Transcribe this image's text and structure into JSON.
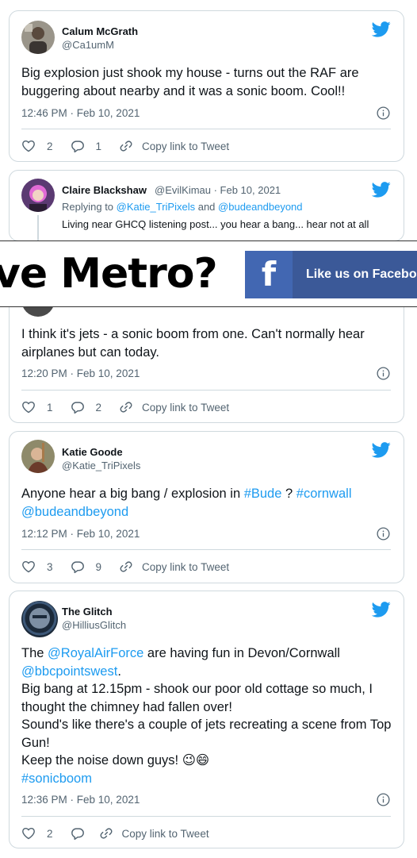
{
  "tweets": [
    {
      "name": "Calum McGrath",
      "handle": "@Ca1umM",
      "text": "Big explosion just shook my house - turns out the RAF are buggering about nearby and it was a sonic boom. Cool!!",
      "timestamp": "12:46 PM · Feb 10, 2021",
      "likes": "2",
      "replies": "1",
      "copy_label": "Copy link to Tweet"
    },
    {
      "name": "Claire Blackshaw",
      "handle_date": "@EvilKimau · Feb 10, 2021",
      "reply_prefix": "Replying to",
      "reply_handle_1": "@Katie_TriPixels",
      "reply_and": "and",
      "reply_handle_2": "@budeandbeyond",
      "partial_text": "Living near GHCQ listening post... you hear a bang... hear not at all"
    },
    {
      "text": "I think it's jets - a sonic boom from one. Can't normally hear airplanes but can today.",
      "timestamp": "12:20 PM · Feb 10, 2021",
      "likes": "1",
      "replies": "2",
      "copy_label": "Copy link to Tweet"
    },
    {
      "name": "Katie Goode",
      "handle": "@Katie_TriPixels",
      "text_a": "Anyone hear a big bang / explosion in ",
      "link_a": "#Bude",
      "text_b": " ? ",
      "link_b": "#cornwall",
      "link_c": "@budeandbeyond",
      "timestamp": "12:12 PM · Feb 10, 2021",
      "likes": "3",
      "replies": "9",
      "copy_label": "Copy link to Tweet"
    },
    {
      "name": "The Glitch",
      "handle": "@HilliusGlitch",
      "t1": "The ",
      "l1": "@RoyalAirForce",
      "t2": " are having fun in Devon/Cornwall",
      "l2": "@bbcpointswest",
      "t3": ".",
      "line3": "Big bang at 12.15pm - shook our poor old cottage so much, I thought the chimney had fallen over!",
      "line4": "Sound's like there's a couple of jets recreating a scene from Top Gun!",
      "line5": "Keep the noise down guys!",
      "emoji": "😉😄",
      "l3": "#sonicboom",
      "timestamp": "12:36 PM · Feb 10, 2021",
      "likes": "2",
      "copy_label": "Copy link to Tweet"
    }
  ],
  "overlay": {
    "headline": "ve Metro?",
    "fb_icon": "f",
    "fb_label": "Like us on Facebook"
  },
  "colors": {
    "link": "#1d9bf0",
    "facebook": "#3b5998",
    "muted": "#536471"
  }
}
